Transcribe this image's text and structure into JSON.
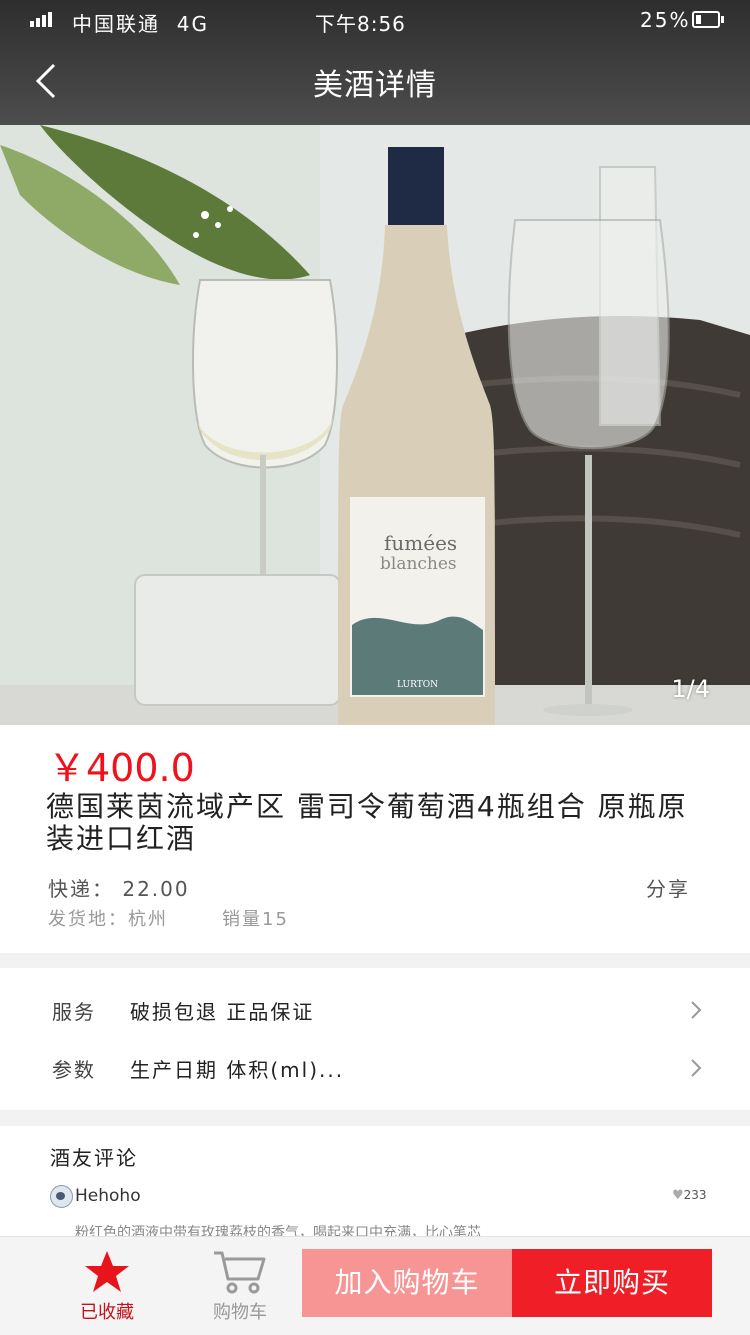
{
  "status_bar": {
    "carrier": "中国联通",
    "network": "4G",
    "time": "下午8:56",
    "battery": "25%"
  },
  "nav": {
    "title": "美酒详情"
  },
  "gallery": {
    "counter": "1/4",
    "label_text_1": "fumées",
    "label_text_2": "blanches",
    "label_brand": "LURTON"
  },
  "product": {
    "price": "￥400.0",
    "name": "德国莱茵流域产区 雷司令葡萄酒4瓶组合 原瓶原装进口红酒",
    "shipping": "快递： 22.00",
    "share": "分享",
    "origin": "发货地：杭州",
    "sales": "销量15"
  },
  "specs": {
    "service": {
      "key": "服务",
      "value": "破损包退  正品保证"
    },
    "params": {
      "key": "参数",
      "value": "生产日期  体积(ml)..."
    }
  },
  "reviews": {
    "heading": "酒友评论",
    "items": [
      {
        "user": "Hehoho",
        "likes": "233",
        "text": "粉红色的酒液中带有玫瑰荔枝的香气，喝起来口中充满，比心笔芯"
      }
    ]
  },
  "bottom_bar": {
    "favorite_label": "已收藏",
    "cart_label": "购物车",
    "add_to_cart": "加入购物车",
    "buy_now": "立即购买"
  },
  "colors": {
    "accent_red": "#f01e26",
    "add_to_cart_pink": "#f79595",
    "price_red": "#f0121b"
  }
}
